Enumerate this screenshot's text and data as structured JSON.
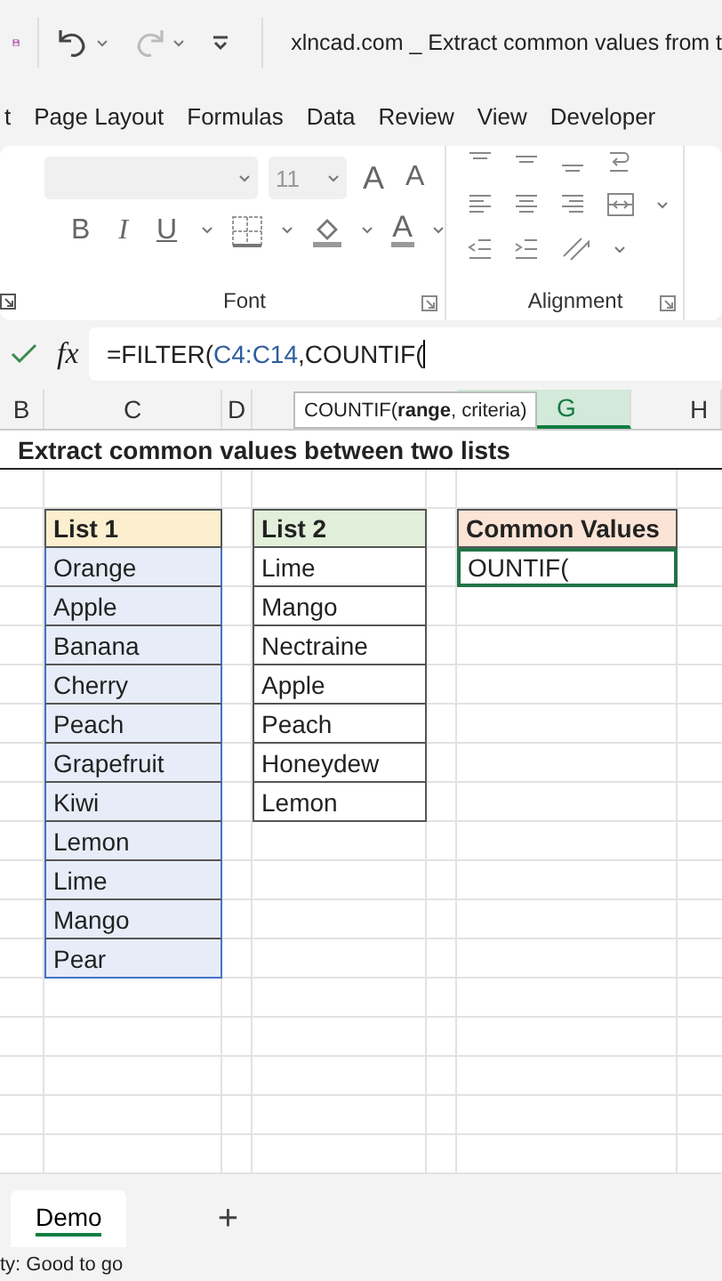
{
  "window": {
    "title": "xlncad.com _ Extract common values from t"
  },
  "quick_access": {
    "redo_disabled": true
  },
  "tabs": [
    {
      "label": "t",
      "selected": false
    },
    {
      "label": "Page Layout",
      "selected": false
    },
    {
      "label": "Formulas",
      "selected": false
    },
    {
      "label": "Data",
      "selected": false
    },
    {
      "label": "Review",
      "selected": false
    },
    {
      "label": "View",
      "selected": false
    },
    {
      "label": "Developer",
      "selected": false
    }
  ],
  "ribbon": {
    "font_group": {
      "label": "Font",
      "size": "11",
      "grow": "A",
      "shrink": "A",
      "bold": "B",
      "italic": "I",
      "underline": "U",
      "font_color": "A"
    },
    "alignment_group": {
      "label": "Alignment"
    }
  },
  "formula_bar": {
    "fx": "fx",
    "parts": [
      {
        "text": "=FILTER(",
        "kind": "plain"
      },
      {
        "text": "C4:C14",
        "kind": "reference"
      },
      {
        "text": ",COUNTIF(",
        "kind": "plain"
      }
    ]
  },
  "column_headers": [
    {
      "label": "B",
      "selected": false
    },
    {
      "label": "C",
      "selected": false
    },
    {
      "label": "D",
      "selected": false
    },
    {
      "label": "G",
      "selected": true
    },
    {
      "label": "H",
      "selected": false
    }
  ],
  "tooltip": "COUNTIF(**range**, criteria)",
  "sheet": {
    "title": "Extract common values between two lists",
    "list1": {
      "header": "List 1",
      "items": [
        "Orange",
        "Apple",
        "Banana",
        "Cherry",
        "Peach",
        "Grapefruit",
        "Kiwi",
        "Lemon",
        "Lime",
        "Mango",
        "Pear"
      ]
    },
    "list2": {
      "header": "List 2",
      "items": [
        "Lime",
        "Mango",
        "Nectraine",
        "Apple",
        "Peach",
        "Honeydew",
        "Lemon"
      ]
    },
    "common": {
      "header": "Common Values",
      "value": "OUNTIF("
    }
  },
  "sheet_tabs": [
    {
      "label": "Demo",
      "selected": true
    }
  ],
  "add_sheet": "+",
  "status_bar": "ty: Good to go"
}
